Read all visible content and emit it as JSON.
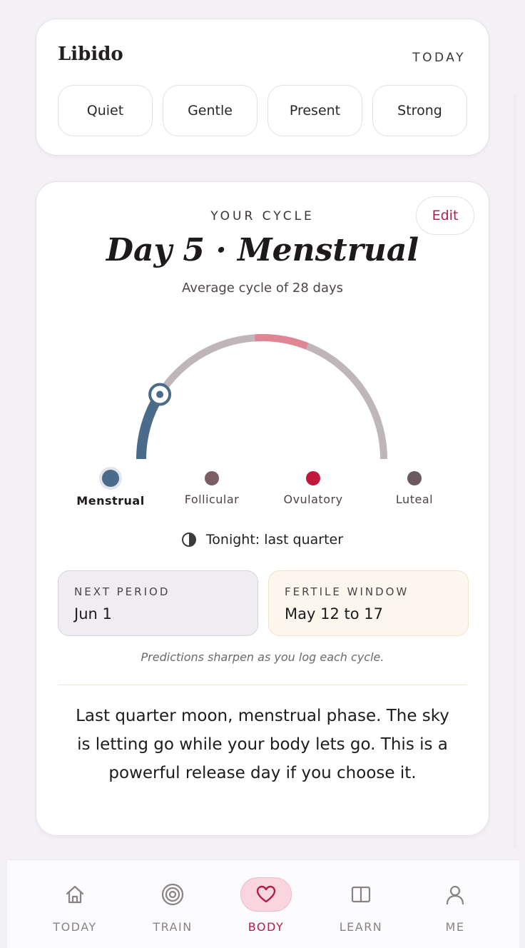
{
  "libido": {
    "title": "Libido",
    "date_tag": "TODAY",
    "options": [
      "Quiet",
      "Gentle",
      "Present",
      "Strong"
    ]
  },
  "cycle": {
    "section_label": "YOUR CYCLE",
    "edit_label": "Edit",
    "headline": "Day 5 · Menstrual",
    "subtitle": "Average cycle of 28 days",
    "current_day": 5,
    "cycle_length": 28,
    "phases": [
      {
        "label": "Menstrual",
        "color": "#4a6b8a",
        "active": true
      },
      {
        "label": "Follicular",
        "color": "#7a5d65",
        "active": false
      },
      {
        "label": "Ovulatory",
        "color": "#c0183d",
        "active": false
      },
      {
        "label": "Luteal",
        "color": "#6b5a5f",
        "active": false
      }
    ],
    "moon": {
      "icon": "half-moon-icon",
      "text": "Tonight: last quarter"
    },
    "next_period": {
      "label": "NEXT PERIOD",
      "value": "Jun 1"
    },
    "fertile_window": {
      "label": "FERTILE WINDOW",
      "value": "May 12 to 17"
    },
    "prediction_note": "Predictions sharpen as you log each cycle.",
    "insight": "Last quarter moon, menstrual phase. The sky is letting go while your body lets go. This is a powerful release day if you choose it."
  },
  "colors": {
    "accent": "#b01e4c",
    "menstrual": "#4a6b8a",
    "ovulatory_arc": "#e08594",
    "track": "#bfb6ba"
  },
  "nav": {
    "items": [
      {
        "label": "TODAY",
        "icon": "home-icon",
        "active": false
      },
      {
        "label": "TRAIN",
        "icon": "target-icon",
        "active": false
      },
      {
        "label": "BODY",
        "icon": "heart-icon",
        "active": true
      },
      {
        "label": "LEARN",
        "icon": "book-icon",
        "active": false
      },
      {
        "label": "ME",
        "icon": "person-icon",
        "active": false
      }
    ]
  }
}
